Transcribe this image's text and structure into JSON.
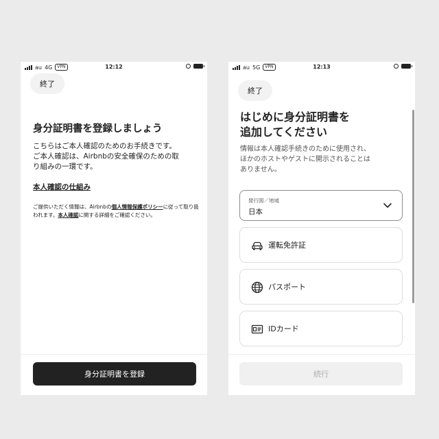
{
  "left_screen": {
    "status": {
      "carrier": "au",
      "network": "4G",
      "vpn": "VPN",
      "time": "12:12"
    },
    "close_label": "終了",
    "title": "身分証明書を登録しましょう",
    "body_line1": "こちらはご本人確認のためのお手続きです。",
    "body_line2": "ご本人確認は、Airbnbの安全確保のための取",
    "body_line3": "り組みの一環です。",
    "link_label": "本人確認の仕組み",
    "notice": {
      "part1": "ご提供いただく情報は、Airbnbの",
      "policy_link": "個人情報保護ポリシー",
      "part2": "に従って取り扱われます。",
      "verify_link": "本人確認",
      "part3": "に関する詳細をご確認ください。"
    },
    "primary_button": "身分証明書を登録"
  },
  "right_screen": {
    "status": {
      "carrier": "au",
      "network": "5G",
      "vpn": "VPN",
      "time": "12:13"
    },
    "close_label": "終了",
    "title_line1": "はじめに身分証明書を",
    "title_line2": "追加してください",
    "desc_line1": "情報は本人確認手続きのために使用され、",
    "desc_line2": "ほかのホストやゲストに開示されることは",
    "desc_line3": "ありません。",
    "country_select": {
      "label": "発行国／地域",
      "value": "日本",
      "icon": "chevron-down-icon"
    },
    "options": [
      {
        "label": "運転免許証",
        "icon": "car-icon"
      },
      {
        "label": "パスポート",
        "icon": "globe-icon"
      },
      {
        "label": "IDカード",
        "icon": "id-card-icon"
      }
    ],
    "continue_button": "続行"
  },
  "colors": {
    "background": "#ebebeb",
    "screen": "#ffffff",
    "primary_button": "#222222",
    "disabled_button": "#f0f0f0",
    "disabled_text": "#b0b0b0",
    "border": "#dddddd"
  }
}
